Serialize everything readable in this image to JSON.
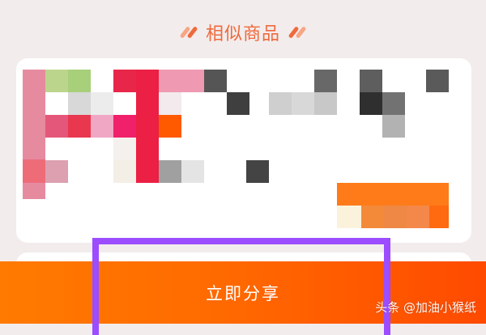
{
  "section": {
    "title": "相似商品"
  },
  "share": {
    "label": "立即分享"
  },
  "watermark": {
    "text": "头条 @加油小猴纸"
  },
  "colors": {
    "accent": "#ef6a3d",
    "share_start": "#ff7a00",
    "share_end": "#ff4a00",
    "highlight": "#9b4dff"
  }
}
